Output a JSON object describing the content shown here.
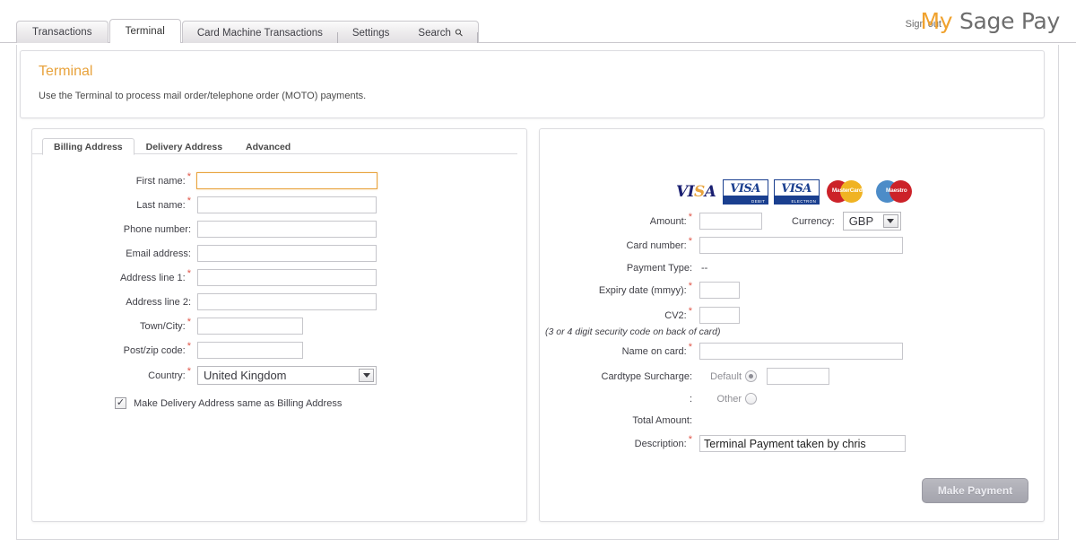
{
  "header": {
    "signout": "Sign out",
    "logo": {
      "my": "My",
      "sage": "Sage Pay"
    },
    "nav": {
      "tabs": [
        {
          "label": "Transactions",
          "active": false
        },
        {
          "label": "Terminal",
          "active": true
        }
      ],
      "group": [
        {
          "label": "Card Machine Transactions"
        },
        {
          "label": "Settings"
        },
        {
          "label": "Search",
          "icon": "search-icon"
        }
      ]
    }
  },
  "page": {
    "title": "Terminal",
    "subtitle": "Use the Terminal to process mail order/telephone order (MOTO) payments."
  },
  "billing": {
    "tabs": [
      {
        "label": "Billing Address",
        "active": true
      },
      {
        "label": "Delivery Address",
        "active": false
      },
      {
        "label": "Advanced",
        "active": false
      }
    ],
    "fields": [
      {
        "label": "First name:",
        "required": true,
        "value": "",
        "focused": true
      },
      {
        "label": "Last name:",
        "required": true,
        "value": "",
        "focused": false
      },
      {
        "label": "Phone number:",
        "required": false,
        "value": "",
        "focused": false
      },
      {
        "label": "Email address:",
        "required": false,
        "value": "",
        "focused": false
      },
      {
        "label": "Address line 1:",
        "required": true,
        "value": "",
        "focused": false
      },
      {
        "label": "Address line 2:",
        "required": false,
        "value": "",
        "focused": false
      },
      {
        "label": "Town/City:",
        "required": true,
        "value": "",
        "focused": false
      },
      {
        "label": "Post/zip code:",
        "required": true,
        "value": "",
        "focused": false
      }
    ],
    "country": {
      "label": "Country:",
      "required": true,
      "value": "United Kingdom"
    },
    "same_address": {
      "label": "Make Delivery Address same as Billing Address",
      "checked": true
    }
  },
  "payment": {
    "card_logos": [
      {
        "name": "visa-logo",
        "text": "VISA"
      },
      {
        "name": "visa-debit-logo",
        "text": "VISA",
        "sub": "DEBIT"
      },
      {
        "name": "visa-electron-logo",
        "text": "VISA",
        "sub": "ELECTRON"
      },
      {
        "name": "mastercard-logo",
        "text": "MasterCard"
      },
      {
        "name": "maestro-logo",
        "text": "Maestro"
      }
    ],
    "amount": {
      "label": "Amount:",
      "required": true,
      "value": ""
    },
    "currency": {
      "label": "Currency:",
      "value": "GBP"
    },
    "card_number": {
      "label": "Card number:",
      "required": true,
      "value": ""
    },
    "payment_type": {
      "label": "Payment Type:",
      "value": "--"
    },
    "expiry": {
      "label": "Expiry date (mmyy):",
      "required": true,
      "value": ""
    },
    "cv2": {
      "label": "CV2:",
      "required": true,
      "value": ""
    },
    "cv2_hint": "(3 or 4 digit security code on back of card)",
    "name_on_card": {
      "label": "Name on card:",
      "required": true,
      "value": ""
    },
    "surcharge": {
      "label": "Cardtype Surcharge:",
      "second_label": ":",
      "default_option": "Default",
      "default_selected": true,
      "default_value": "",
      "other_option": "Other",
      "other_selected": false
    },
    "total_amount": {
      "label": "Total Amount:",
      "value": ""
    },
    "description": {
      "label": "Description:",
      "required": true,
      "value": "Terminal Payment taken by chris"
    },
    "submit": "Make Payment"
  }
}
